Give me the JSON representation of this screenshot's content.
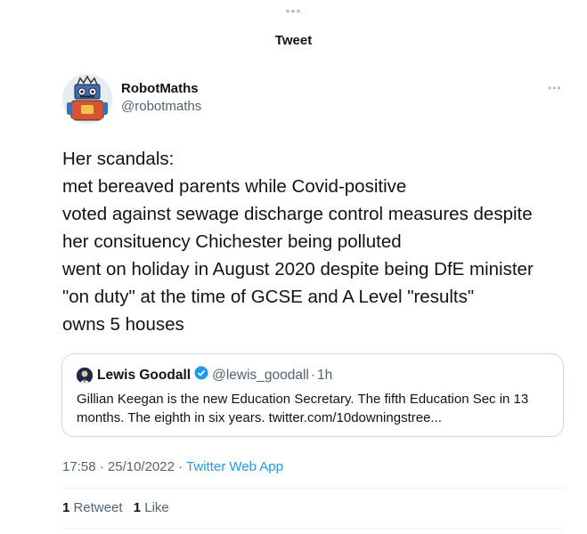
{
  "header": {
    "title": "Tweet"
  },
  "author": {
    "name": "RobotMaths",
    "handle": "@robotmaths",
    "avatar_icon": "robot-avatar-icon"
  },
  "tweet": {
    "lines": [
      "Her scandals:",
      "met bereaved parents while Covid-positive",
      "voted against sewage discharge control measures despite",
      "her consituency Chichester being polluted",
      "went on holiday in August 2020 despite being DfE minister",
      "\"on duty\" at the time of GCSE and A Level \"results\"",
      "owns 5 houses"
    ]
  },
  "quote": {
    "name": "Lewis Goodall",
    "handle": "@lewis_goodall",
    "separator": "·",
    "time": "1h",
    "verified_color": "#1d9bf0",
    "body": "Gillian Keegan is the new Education Secretary. The fifth Education Sec in 13 months. The eighth in six years. twitter.com/10downingstree..."
  },
  "meta": {
    "time": "17:58",
    "sep1": " · ",
    "date": "25/10/2022",
    "sep2": " · ",
    "source": "Twitter Web App"
  },
  "stats": {
    "retweets_count": "1",
    "retweets_label": "Retweet",
    "likes_count": "1",
    "likes_label": "Like"
  },
  "colors": {
    "accent": "#1d9bf0",
    "secondary_text": "#536471",
    "border": "#cfd9de"
  }
}
